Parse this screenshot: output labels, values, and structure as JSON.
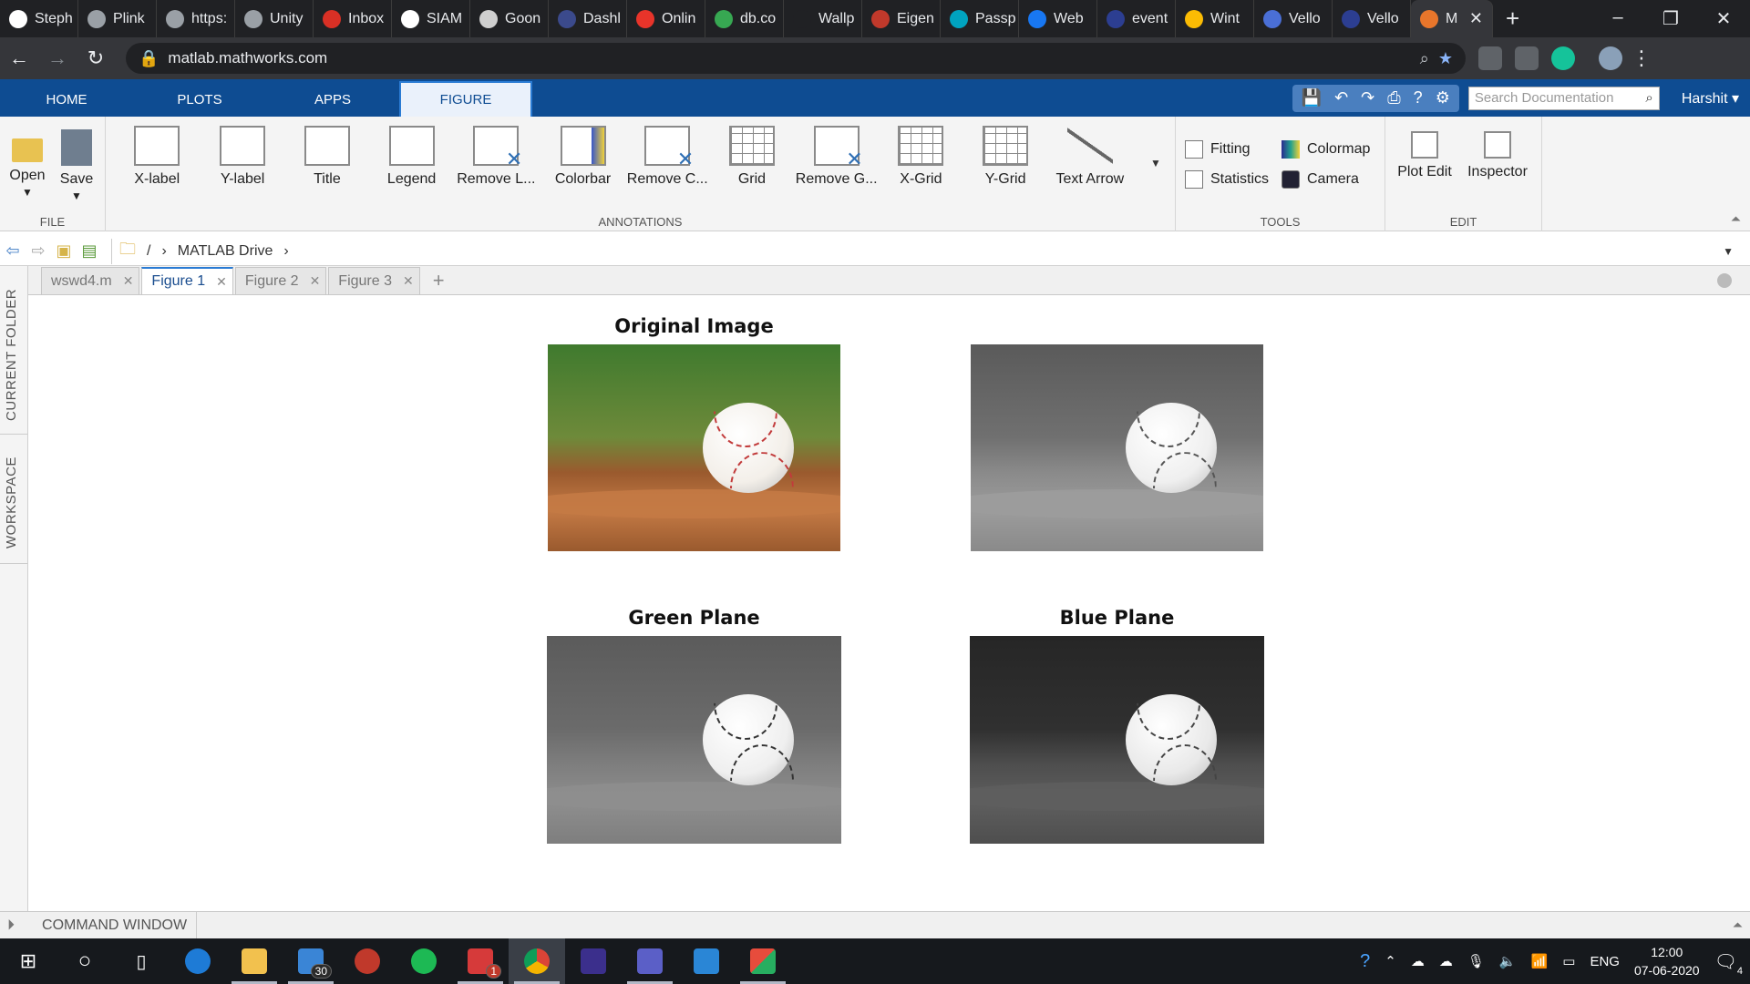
{
  "browser": {
    "tabs": [
      {
        "label": "Steph",
        "color": "#ffffff"
      },
      {
        "label": "Plink",
        "color": "#9aa0a6"
      },
      {
        "label": "https:",
        "color": "#9aa0a6"
      },
      {
        "label": "Unity",
        "color": "#9aa0a6"
      },
      {
        "label": "Inbox",
        "color": "#d93025"
      },
      {
        "label": "SIAM",
        "color": "#ffffff"
      },
      {
        "label": "Goon",
        "color": "#cfcfcf"
      },
      {
        "label": "Dashl",
        "color": "#3b4a8c"
      },
      {
        "label": "Onlin",
        "color": "#e8342a"
      },
      {
        "label": "db.co",
        "color": "#37a852"
      },
      {
        "label": "Wallp",
        "color": "#202124"
      },
      {
        "label": "Eigen",
        "color": "#c0392b"
      },
      {
        "label": "Passp",
        "color": "#00a3bf"
      },
      {
        "label": "Web",
        "color": "#1877f2"
      },
      {
        "label": "event",
        "color": "#2c3e91"
      },
      {
        "label": "Wint",
        "color": "#fbbc04"
      },
      {
        "label": "Vello",
        "color": "#4a6fd6"
      },
      {
        "label": "Vello",
        "color": "#2c3e91"
      }
    ],
    "active_tab": {
      "label": "M",
      "color": "#e8762b"
    },
    "url": "matlab.mathworks.com"
  },
  "matlab": {
    "tabs": [
      "HOME",
      "PLOTS",
      "APPS",
      "FIGURE"
    ],
    "search_placeholder": "Search Documentation",
    "user": "Harshit",
    "file": {
      "label": "FILE",
      "open": "Open",
      "save": "Save"
    },
    "annotations": {
      "label": "ANNOTATIONS",
      "buttons": [
        "X-label",
        "Y-label",
        "Title",
        "Legend",
        "Remove L...",
        "Colorbar",
        "Remove C...",
        "Grid",
        "Remove G...",
        "X-Grid",
        "Y-Grid",
        "Text Arrow"
      ]
    },
    "tools": {
      "label": "TOOLS",
      "fitting": "Fitting",
      "statistics": "Statistics",
      "colormap": "Colormap",
      "camera": "Camera"
    },
    "edit": {
      "label": "EDIT",
      "plot_edit": "Plot Edit",
      "inspector": "Inspector"
    },
    "path": {
      "root": "/",
      "folder": "MATLAB Drive"
    },
    "side": {
      "current_folder": "CURRENT FOLDER",
      "workspace": "WORKSPACE"
    },
    "editor_tabs": [
      "wswd4.m",
      "Figure 1",
      "Figure 2",
      "Figure 3"
    ],
    "active_editor_tab": "Figure 1",
    "command_window": "COMMAND WINDOW"
  },
  "figure": {
    "subplots": [
      {
        "title": "Original Image",
        "mode": "color"
      },
      {
        "title": "",
        "mode": "gray"
      },
      {
        "title": "Green Plane",
        "mode": "green"
      },
      {
        "title": "Blue Plane",
        "mode": "blue"
      }
    ]
  },
  "taskbar": {
    "mail_badge": "30",
    "app_badge": "1",
    "language": "ENG",
    "time": "12:00",
    "date": "07-06-2020",
    "notifications": "4"
  }
}
